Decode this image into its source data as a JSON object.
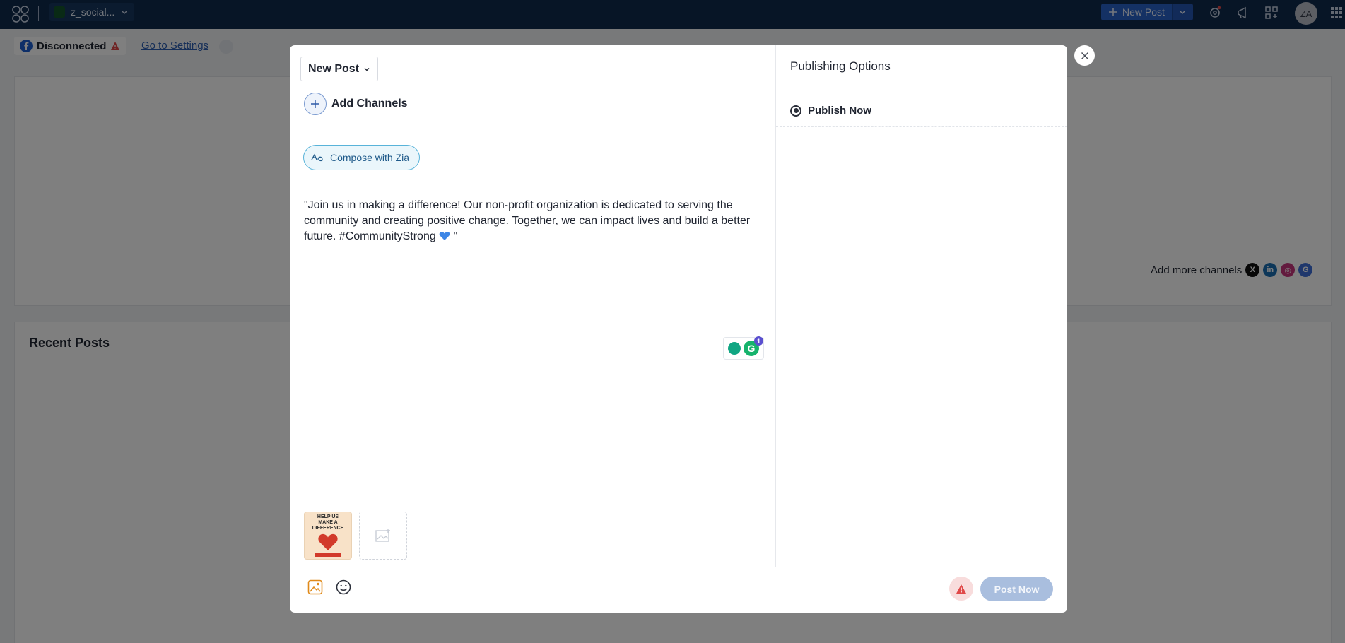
{
  "topbar": {
    "brand_label": "z_social...",
    "new_post_label": "New Post",
    "avatar_initials": "ZA"
  },
  "background": {
    "status_label": "Disconnected",
    "settings_link": "Go to Settings",
    "add_more_channels": "Add more channels",
    "recent_posts_title": "Recent Posts",
    "social_icons": [
      {
        "name": "x",
        "glyph": "X",
        "color": "#111111"
      },
      {
        "name": "linkedin",
        "glyph": "in",
        "color": "#1b6fb3"
      },
      {
        "name": "instagram",
        "glyph": "◎",
        "color": "#c7357c"
      },
      {
        "name": "google",
        "glyph": "G",
        "color": "#3f6fd8"
      }
    ]
  },
  "modal": {
    "post_type_label": "New Post",
    "add_channels_label": "Add Channels",
    "compose_zia_label": "Compose with Zia",
    "post_text_main": "\"Join us in making a difference! Our non-profit organization is dedicated to serving the community and creating positive change. Together, we can impact lives and build a better future. #CommunityStrong ",
    "post_text_end": " \"",
    "grammarly_badge": "1",
    "thumbnail": {
      "line1": "HELP US",
      "line2": "MAKE A",
      "line3": "DIFFERENCE"
    },
    "publishing_title": "Publishing Options",
    "publish_option": "Publish Now",
    "post_button": "Post Now"
  },
  "colors": {
    "topbar": "#0f2a4d",
    "accent": "#2962c9",
    "zia_border": "#58b3d9",
    "post_button_disabled": "#a9bede",
    "warning": "#e04848"
  }
}
